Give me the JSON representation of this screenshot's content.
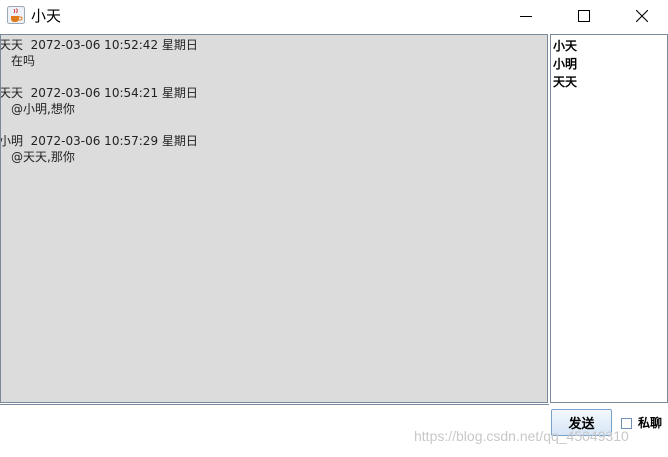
{
  "window": {
    "title": "小天",
    "icon": "java-cup-icon"
  },
  "chat": {
    "messages": [
      {
        "header": "天天  2072-03-06 10:52:42 星期日",
        "text": "在吗"
      },
      {
        "header": "天天  2072-03-06 10:54:21 星期日",
        "text": "@小明,想你"
      },
      {
        "header": "小明  2072-03-06 10:57:29 星期日",
        "text": "@天天,那你"
      }
    ]
  },
  "users": [
    "小天",
    "小明",
    "天天"
  ],
  "controls": {
    "send_label": "发送",
    "private_label": "私聊",
    "private_checked": false
  },
  "watermark": "https://blog.csdn.net/qq_45049310"
}
